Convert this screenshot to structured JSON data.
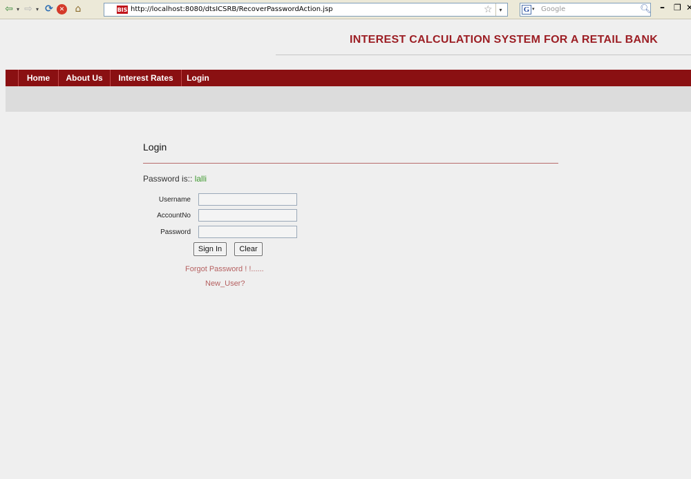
{
  "browser": {
    "back_icon": "back-arrow-icon",
    "dropdown_glyph": "▾",
    "url": "http://localhost:8080/dtsICSRB/RecoverPasswordAction.jsp",
    "favicon_text": "BIS",
    "search_engine_letter": "G",
    "search_placeholder": "Google"
  },
  "header": {
    "title": "INTEREST CALCULATION SYSTEM FOR A RETAIL BANK"
  },
  "nav": {
    "items": [
      {
        "label": "Home"
      },
      {
        "label": "About Us"
      },
      {
        "label": "Interest Rates"
      },
      {
        "label": "Login"
      }
    ]
  },
  "login": {
    "title": "Login",
    "message_prefix": "Password is::",
    "recovered_password": "lalli",
    "fields": {
      "username_label": "Username",
      "username_value": "",
      "accountno_label": "AccountNo",
      "accountno_value": "",
      "password_label": "Password",
      "password_value": ""
    },
    "sign_in_label": "Sign In",
    "clear_label": "Clear",
    "forgot_link": "Forgot Password ! !......",
    "new_user_link": "New_User?"
  },
  "colors": {
    "brand_red": "#8a1012",
    "title_red": "#9c1e24",
    "success_green": "#3e9a2e",
    "link_red": "#b56060"
  }
}
